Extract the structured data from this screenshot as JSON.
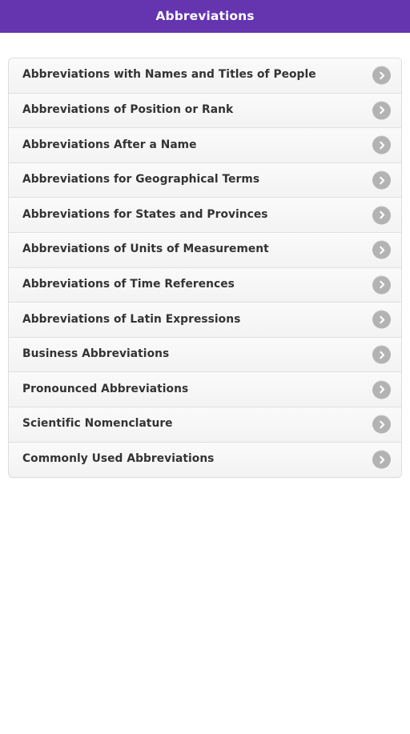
{
  "header": {
    "title": "Abbreviations",
    "background_color": "#6535b0",
    "text_color": "#ffffff"
  },
  "theme": {
    "accent_color": "#6535b0",
    "page_background": "#ffffff",
    "list_item_background": "#f7f7f7",
    "list_item_border_color": "#e0e0e0",
    "list_item_text_color": "#333333",
    "chevron_circle_color": "#b3b3b3",
    "chevron_arrow_color": "#ffffff"
  },
  "list": {
    "icon_name": "chevron-right-icon",
    "items": [
      {
        "label": "Abbreviations with Names and Titles of People"
      },
      {
        "label": "Abbreviations of Position or Rank"
      },
      {
        "label": "Abbreviations After a Name"
      },
      {
        "label": "Abbreviations for Geographical Terms"
      },
      {
        "label": "Abbreviations for States and Provinces"
      },
      {
        "label": "Abbreviations of Units of Measurement"
      },
      {
        "label": "Abbreviations of Time References"
      },
      {
        "label": "Abbreviations of Latin Expressions"
      },
      {
        "label": "Business Abbreviations"
      },
      {
        "label": "Pronounced Abbreviations"
      },
      {
        "label": "Scientific Nomenclature"
      },
      {
        "label": "Commonly Used Abbreviations"
      }
    ]
  }
}
